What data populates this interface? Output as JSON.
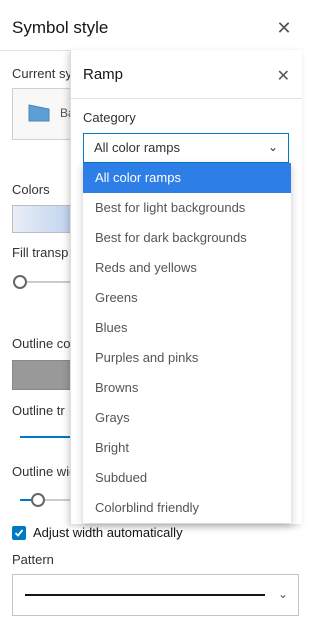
{
  "symbol_style": {
    "title": "Symbol style",
    "current_symbol_label": "Current sy",
    "current_symbol_text": "Ba",
    "colors_label": "Colors",
    "fill_transparency_label": "Fill transp",
    "outline_color_label": "Outline co",
    "outline_transparency_label": "Outline tr",
    "outline_width_label": "Outline wid",
    "adjust_width_label": "Adjust width automatically",
    "adjust_width_checked": true,
    "pattern_label": "Pattern"
  },
  "ramp": {
    "title": "Ramp",
    "category_label": "Category",
    "category_value": "All color ramps",
    "options": [
      "All color ramps",
      "Best for light backgrounds",
      "Best for dark backgrounds",
      "Reds and yellows",
      "Greens",
      "Blues",
      "Purples and pinks",
      "Browns",
      "Grays",
      "Bright",
      "Subdued",
      "Colorblind friendly"
    ],
    "selected_index": 0
  },
  "colors": {
    "accent": "#007ac2",
    "selected_option": "#2d7ee6"
  },
  "icons": {
    "close": "✕",
    "chevron_down": "⌄",
    "check": "✓"
  }
}
